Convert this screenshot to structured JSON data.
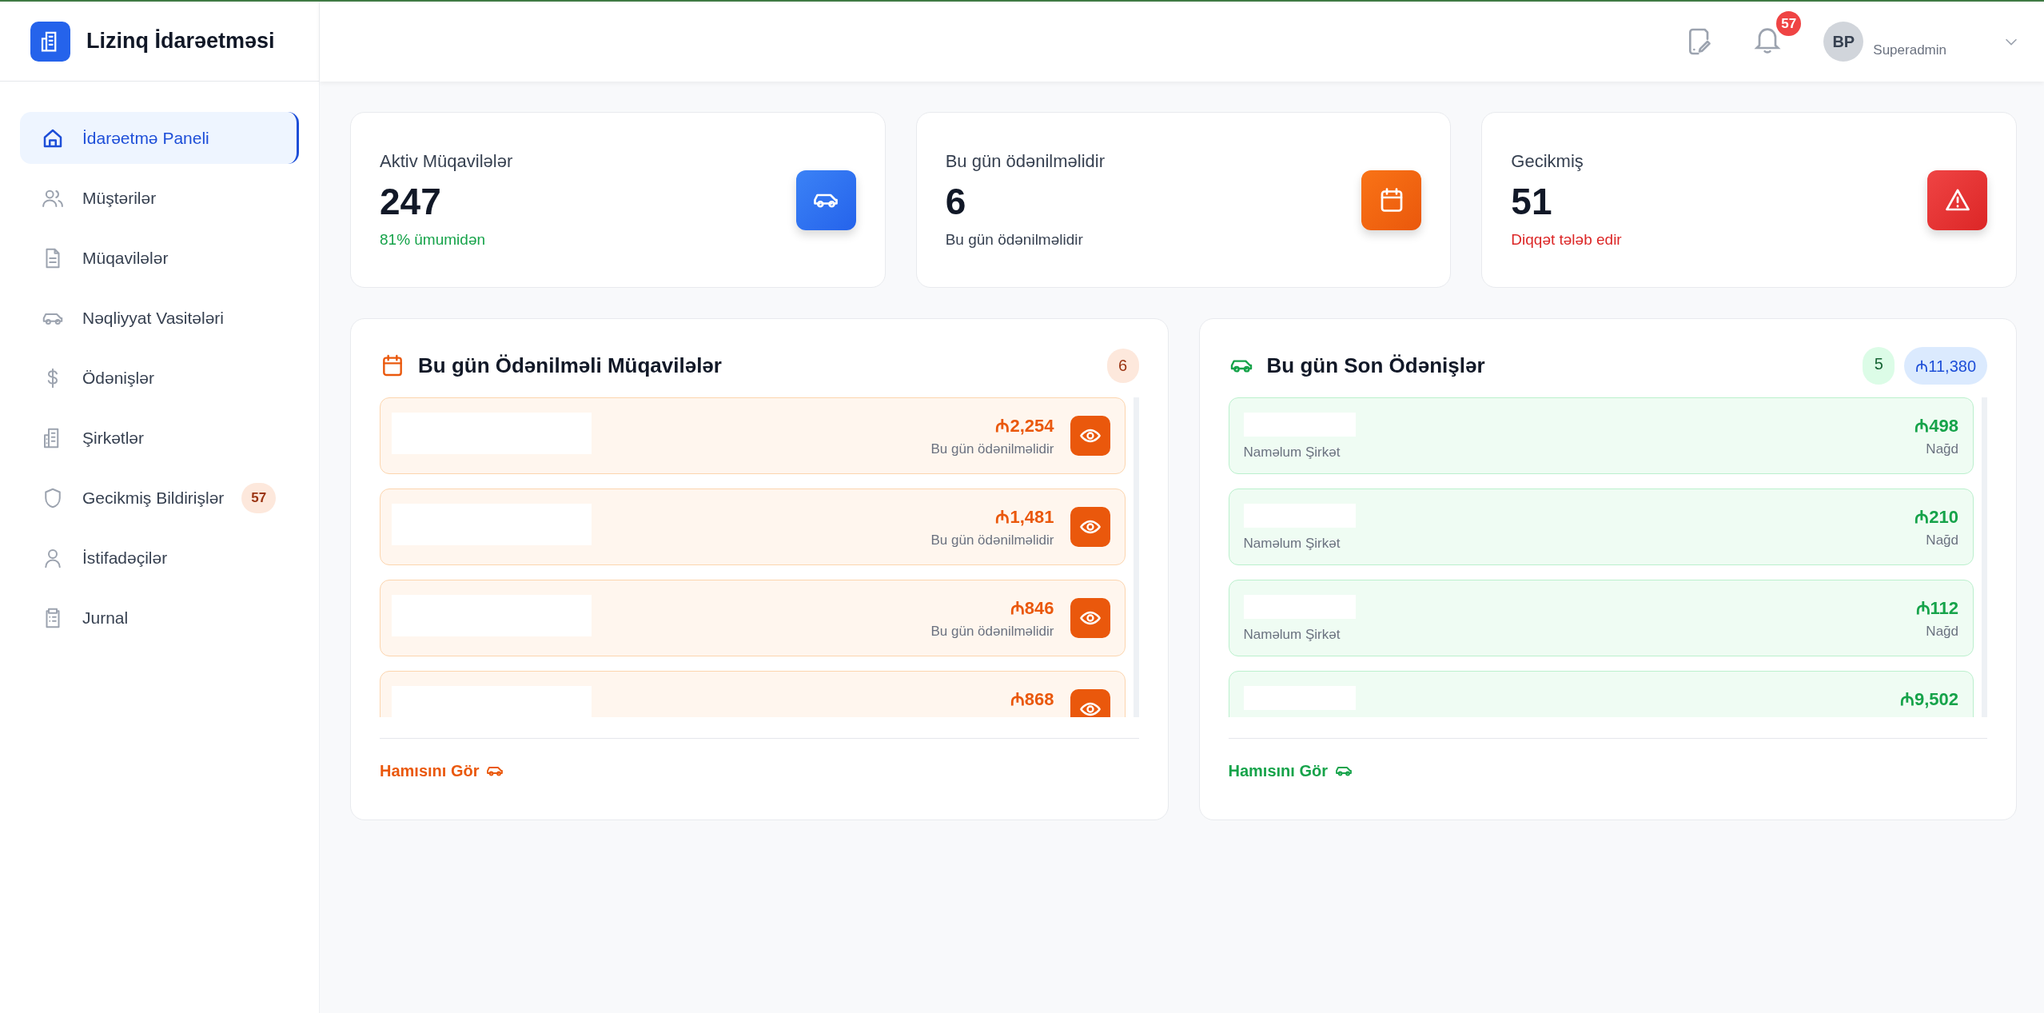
{
  "brand": {
    "title": "Lizinq İdarəetməsi"
  },
  "sidebar": {
    "items": [
      {
        "label": "İdarəetmə Paneli",
        "selected": true
      },
      {
        "label": "Müştərilər",
        "selected": false
      },
      {
        "label": "Müqavilələr",
        "selected": false
      },
      {
        "label": "Nəqliyyat Vasitələri",
        "selected": false
      },
      {
        "label": "Ödənişlər",
        "selected": false
      },
      {
        "label": "Şirkətlər",
        "selected": false
      },
      {
        "label": "Gecikmiş Bildirişlər",
        "selected": false,
        "badge": "57"
      },
      {
        "label": "İstifadəçilər",
        "selected": false
      },
      {
        "label": "Jurnal",
        "selected": false
      }
    ]
  },
  "header": {
    "notification_count": "57",
    "avatar_initials": "BP",
    "user_role": "Superadmin"
  },
  "stats": [
    {
      "label": "Aktiv Müqavilələr",
      "value": "247",
      "note": "81% ümumidən"
    },
    {
      "label": "Bu gün ödənilməlidir",
      "value": "6",
      "note": "Bu gün ödənilməlidir"
    },
    {
      "label": "Gecikmiş",
      "value": "51",
      "note": "Diqqət tələb edir"
    }
  ],
  "due_panel": {
    "title": "Bu gün Ödənilməli Müqavilələr",
    "count": "6",
    "rows": [
      {
        "amount": "₼2,254",
        "note": "Bu gün ödənilməlidir"
      },
      {
        "amount": "₼1,481",
        "note": "Bu gün ödənilməlidir"
      },
      {
        "amount": "₼846",
        "note": "Bu gün ödənilməlidir"
      },
      {
        "amount": "₼868"
      }
    ],
    "link": "Hamısını Gör"
  },
  "payments_panel": {
    "title": "Bu gün Son Ödənişlər",
    "count": "5",
    "total": "₼11,380",
    "rows": [
      {
        "company": "Naməlum Şirkət",
        "amount": "₼498",
        "method": "Nağd"
      },
      {
        "company": "Naməlum Şirkət",
        "amount": "₼210",
        "method": "Nağd"
      },
      {
        "company": "Naməlum Şirkət",
        "amount": "₼112",
        "method": "Nağd"
      },
      {
        "amount": "₼9,502"
      }
    ],
    "link": "Hamısını Gör"
  }
}
